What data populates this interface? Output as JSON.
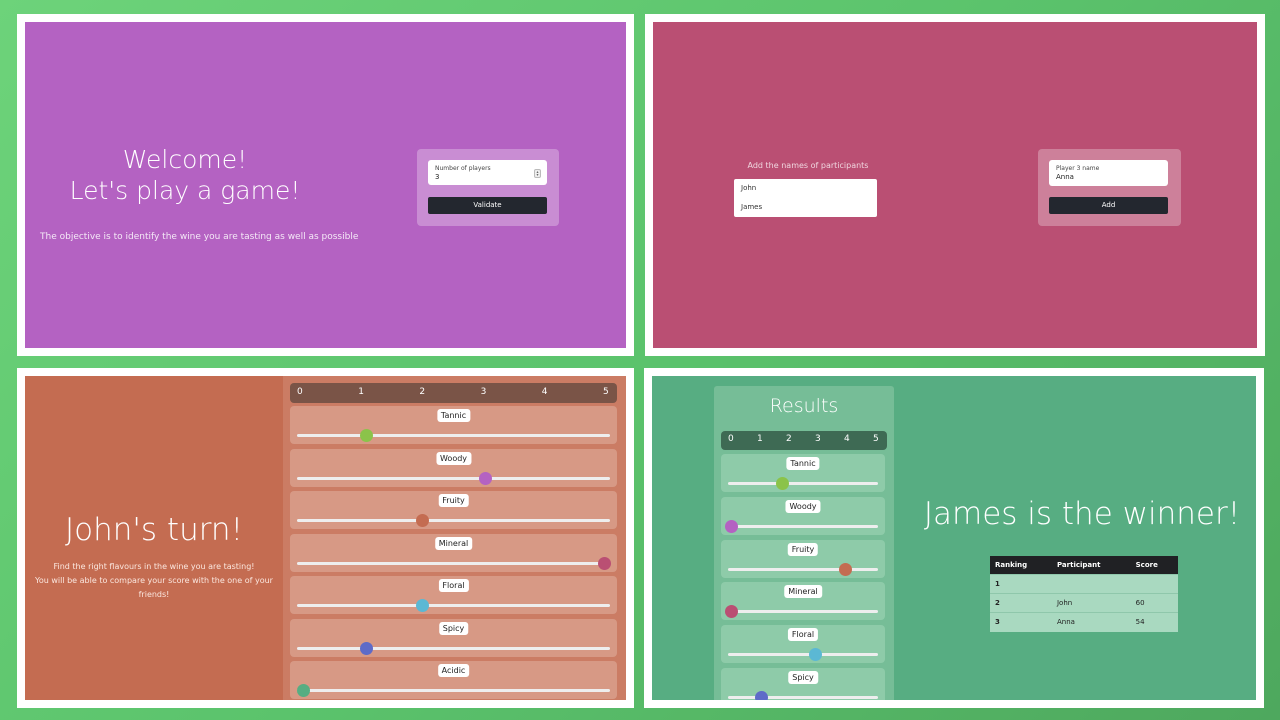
{
  "welcome_screen": {
    "heading_line1": "Welcome!",
    "heading_line2": "Let's play a game!",
    "objective": "The objective is to identify the wine you are tasting as well as possible",
    "players_field_label": "Number of players",
    "players_field_value": "3",
    "validate_label": "Validate",
    "bg_color": "#b462c2"
  },
  "names_screen": {
    "title": "Add the names of participants",
    "names": [
      "John",
      "James"
    ],
    "player_field_label": "Player 3 name",
    "player_field_value": "Anna",
    "add_label": "Add",
    "bg_color": "#ba4f73"
  },
  "tasting_screen": {
    "turn_title": "John's turn!",
    "instructions_line1": "Find the right flavours in the wine you are tasting!",
    "instructions_line2": "You will be able to compare your score with the one of your friends!",
    "scale": [
      "0",
      "1",
      "2",
      "3",
      "4",
      "5"
    ],
    "sliders": [
      {
        "label": "Tannic",
        "value": 1.1,
        "color": "#8bc34a"
      },
      {
        "label": "Woody",
        "value": 3.0,
        "color": "#b462c2"
      },
      {
        "label": "Fruity",
        "value": 2.0,
        "color": "#c46c51"
      },
      {
        "label": "Mineral",
        "value": 4.9,
        "color": "#ba4f73"
      },
      {
        "label": "Floral",
        "value": 2.0,
        "color": "#5bb8d4"
      },
      {
        "label": "Spicy",
        "value": 1.1,
        "color": "#5e6bc8"
      },
      {
        "label": "Acidic",
        "value": 0.1,
        "color": "#57ad82"
      }
    ],
    "bg_color": "#c46c51"
  },
  "results_screen": {
    "results_title": "Results",
    "scale": [
      "0",
      "1",
      "2",
      "3",
      "4",
      "5"
    ],
    "sliders": [
      {
        "label": "Tannic",
        "value": 1.8,
        "color": "#8bc34a"
      },
      {
        "label": "Woody",
        "value": 0.1,
        "color": "#b462c2"
      },
      {
        "label": "Fruity",
        "value": 3.9,
        "color": "#c46c51"
      },
      {
        "label": "Mineral",
        "value": 0.1,
        "color": "#ba4f73"
      },
      {
        "label": "Floral",
        "value": 2.9,
        "color": "#5bb8d4"
      },
      {
        "label": "Spicy",
        "value": 1.1,
        "color": "#5e6bc8"
      }
    ],
    "winner_text": "James is the winner!",
    "table_headers": [
      "Ranking",
      "Participant",
      "Score"
    ],
    "table_rows": [
      [
        "1",
        "",
        ""
      ],
      [
        "2",
        "John",
        "60"
      ],
      [
        "3",
        "Anna",
        "54"
      ]
    ],
    "bg_color": "#57ad82"
  }
}
